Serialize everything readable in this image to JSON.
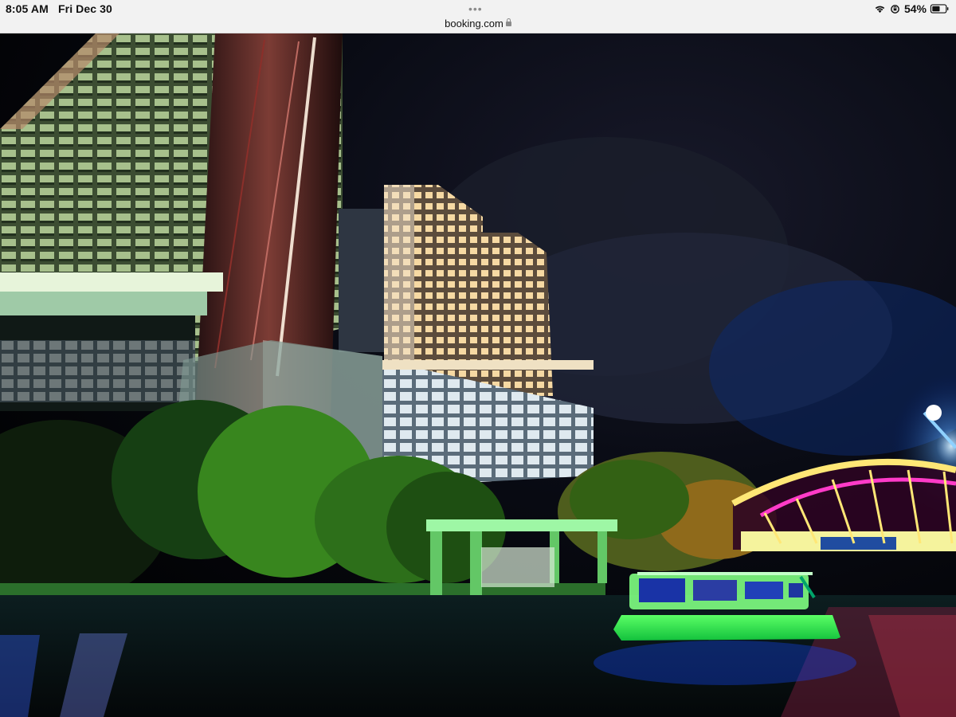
{
  "status_bar": {
    "time": "8:05 AM",
    "date": "Fri Dec 30",
    "url": "booking.com",
    "battery": "54%"
  },
  "icons": {
    "lock": "lock-icon",
    "wifi": "wifi-icon",
    "orientation": "orientation-lock-icon",
    "battery": "battery-icon",
    "more": "more-dots-icon"
  },
  "photo": {
    "subject": "night riverside towers with illuminated boat and arched bridge"
  }
}
